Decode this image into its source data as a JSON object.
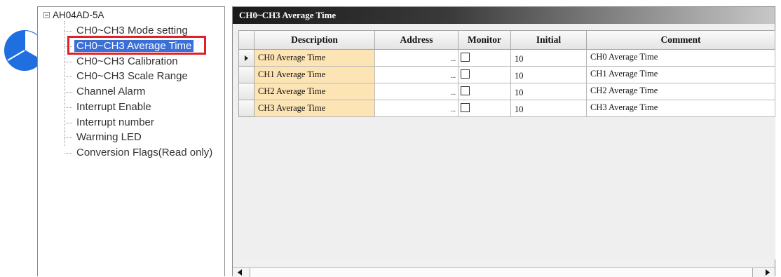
{
  "tree": {
    "root_label": "AH04AD-5A",
    "items": [
      {
        "label": "CH0~CH3 Mode setting"
      },
      {
        "label": "CH0~CH3 Average Time",
        "selected": true
      },
      {
        "label": "CH0~CH3 Calibration"
      },
      {
        "label": "CH0~CH3 Scale Range"
      },
      {
        "label": "Channel Alarm"
      },
      {
        "label": "Interrupt Enable"
      },
      {
        "label": "Interrupt number"
      },
      {
        "label": "Warming LED"
      },
      {
        "label": "Conversion Flags(Read only)"
      }
    ]
  },
  "panel": {
    "title": "CH0~CH3 Average Time"
  },
  "table": {
    "columns": [
      "Description",
      "Address",
      "Monitor",
      "Initial",
      "Comment"
    ],
    "rows": [
      {
        "description": "CH0 Average Time",
        "address": "",
        "monitor": false,
        "initial": "10",
        "comment": "CH0 Average Time",
        "current": true
      },
      {
        "description": "CH1 Average Time",
        "address": "",
        "monitor": false,
        "initial": "10",
        "comment": "CH1 Average Time",
        "current": false
      },
      {
        "description": "CH2 Average Time",
        "address": "",
        "monitor": false,
        "initial": "10",
        "comment": "CH2 Average Time",
        "current": false
      },
      {
        "description": "CH3 Average Time",
        "address": "",
        "monitor": false,
        "initial": "10",
        "comment": "CH3 Average Time",
        "current": false
      }
    ],
    "address_button_label": "..."
  },
  "colors": {
    "selection_highlight": "#3a6fd8",
    "annotation_red": "#e0202a",
    "annotation_blue": "#1f6fe0",
    "description_cell_bg": "#fde4b5"
  },
  "icons": {
    "step_marker": "blue-pie-circle-icon",
    "pointer": "blue-arrow-icon"
  }
}
